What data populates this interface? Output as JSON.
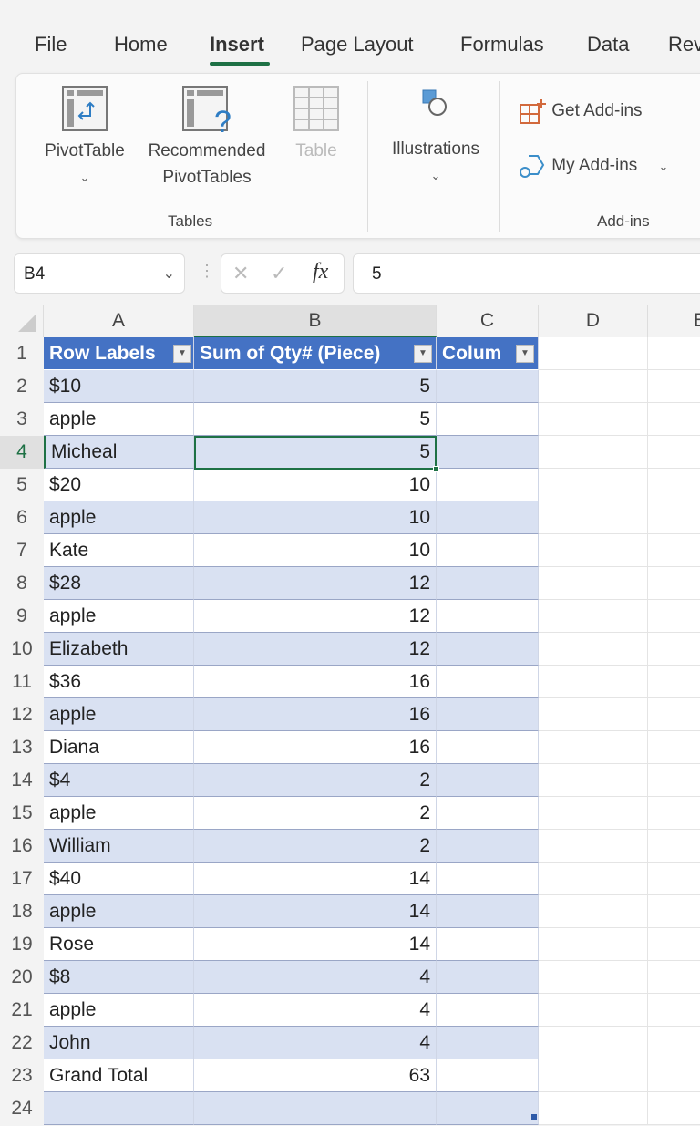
{
  "ribbon_tabs": [
    "File",
    "Home",
    "Insert",
    "Page Layout",
    "Formulas",
    "Data",
    "Rev"
  ],
  "active_tab": "Insert",
  "ribbon": {
    "pivot_table": "PivotTable",
    "recommended_line1": "Recommended",
    "recommended_line2": "PivotTables",
    "table": "Table",
    "tables_group": "Tables",
    "illustrations": "Illustrations",
    "get_addins": "Get Add-ins",
    "my_addins": "My Add-ins",
    "addins_group": "Add-ins",
    "chevron": "⌄"
  },
  "formula_bar": {
    "name_box": "B4",
    "cancel_icon": "✕",
    "enter_icon": "✓",
    "fx": "fx",
    "value": "5"
  },
  "columns": [
    "A",
    "B",
    "C",
    "D",
    "E"
  ],
  "selected_column": "B",
  "header_row": {
    "row": "1",
    "a": "Row Labels",
    "b": "Sum of Qty# (Piece)",
    "c": "Colum"
  },
  "rows": [
    {
      "n": "2",
      "label": "$10",
      "value": "5"
    },
    {
      "n": "3",
      "label": "apple",
      "value": "5"
    },
    {
      "n": "4",
      "label": "Micheal",
      "value": "5"
    },
    {
      "n": "5",
      "label": "$20",
      "value": "10"
    },
    {
      "n": "6",
      "label": "apple",
      "value": "10"
    },
    {
      "n": "7",
      "label": "Kate",
      "value": "10"
    },
    {
      "n": "8",
      "label": "$28",
      "value": "12"
    },
    {
      "n": "9",
      "label": "apple",
      "value": "12"
    },
    {
      "n": "10",
      "label": "Elizabeth",
      "value": "12"
    },
    {
      "n": "11",
      "label": "$36",
      "value": "16"
    },
    {
      "n": "12",
      "label": "apple",
      "value": "16"
    },
    {
      "n": "13",
      "label": "Diana",
      "value": "16"
    },
    {
      "n": "14",
      "label": "$4",
      "value": "2"
    },
    {
      "n": "15",
      "label": "apple",
      "value": "2"
    },
    {
      "n": "16",
      "label": "William",
      "value": "2"
    },
    {
      "n": "17",
      "label": "$40",
      "value": "14"
    },
    {
      "n": "18",
      "label": "apple",
      "value": "14"
    },
    {
      "n": "19",
      "label": "Rose",
      "value": "14"
    },
    {
      "n": "20",
      "label": "$8",
      "value": "4"
    },
    {
      "n": "21",
      "label": "apple",
      "value": "4"
    },
    {
      "n": "22",
      "label": "John",
      "value": "4"
    },
    {
      "n": "23",
      "label": "Grand Total",
      "value": "63"
    },
    {
      "n": "24",
      "label": "",
      "value": ""
    }
  ],
  "selected_row": "4",
  "colors": {
    "accent_green": "#1e7145",
    "table_header_blue": "#4472c4",
    "band_blue": "#d9e1f2"
  }
}
